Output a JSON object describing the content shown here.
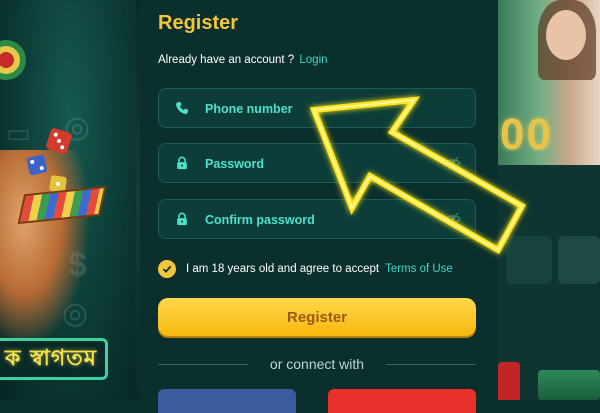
{
  "form": {
    "title": "Register",
    "account_prompt": "Already have an account ?",
    "login_link": "Login",
    "phone_placeholder": "Phone number",
    "password_placeholder": "Password",
    "confirm_placeholder": "Confirm password",
    "agree_text": "I am 18 years old and agree to accept",
    "terms_link": "Terms of Use",
    "agree_checked": true,
    "register_button": "Register",
    "connect_text": "or connect with"
  },
  "left_banner": {
    "welcome_text": "ক স্বাগতম"
  },
  "icons": {
    "phone": "phone-icon",
    "lock": "lock-icon",
    "eye": "eye-hidden-icon",
    "check": "checkmark-icon"
  },
  "colors": {
    "background": "#0b2f2c",
    "accent_yellow": "#f3c53a",
    "link_teal": "#3fd8c5",
    "field_text": "#4fe0cc",
    "facebook": "#3b5b9f",
    "google": "#e7312a"
  }
}
